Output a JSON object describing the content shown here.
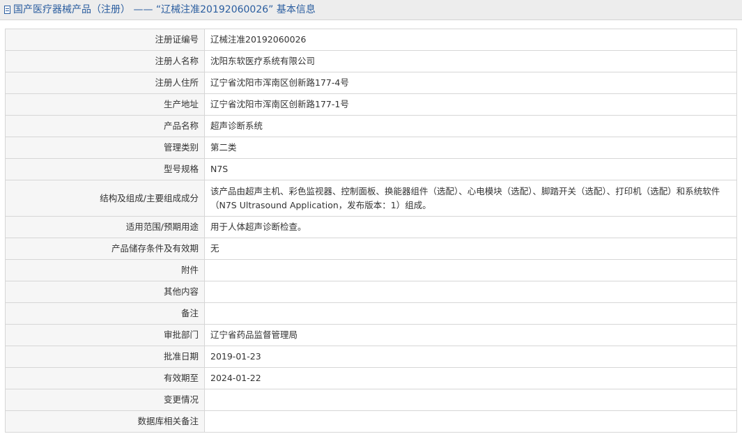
{
  "header": {
    "title": "国产医疗器械产品（注册） —— “辽械注准20192060026” 基本信息",
    "icon": "document-icon"
  },
  "rows": [
    {
      "label": "注册证编号",
      "value": "辽械注准20192060026"
    },
    {
      "label": "注册人名称",
      "value": "沈阳东软医疗系统有限公司"
    },
    {
      "label": "注册人住所",
      "value": "辽宁省沈阳市浑南区创新路177-4号"
    },
    {
      "label": "生产地址",
      "value": "辽宁省沈阳市浑南区创新路177-1号"
    },
    {
      "label": "产品名称",
      "value": "超声诊断系统"
    },
    {
      "label": "管理类别",
      "value": "第二类"
    },
    {
      "label": "型号规格",
      "value": "N7S"
    },
    {
      "label": "结构及组成/主要组成成分",
      "value": "该产品由超声主机、彩色监视器、控制面板、换能器组件（选配）、心电模块（选配）、脚踏开关（选配）、打印机（选配）和系统软件（N7S Ultrasound Application，发布版本：1）组成。"
    },
    {
      "label": "适用范围/预期用途",
      "value": "用于人体超声诊断检查。"
    },
    {
      "label": "产品储存条件及有效期",
      "value": "无"
    },
    {
      "label": "附件",
      "value": ""
    },
    {
      "label": "其他内容",
      "value": ""
    },
    {
      "label": "备注",
      "value": ""
    },
    {
      "label": "审批部门",
      "value": "辽宁省药品监督管理局"
    },
    {
      "label": "批准日期",
      "value": "2019-01-23"
    },
    {
      "label": "有效期至",
      "value": "2024-01-22"
    },
    {
      "label": "变更情况",
      "value": ""
    },
    {
      "label": "数据库相关备注",
      "value": ""
    }
  ]
}
